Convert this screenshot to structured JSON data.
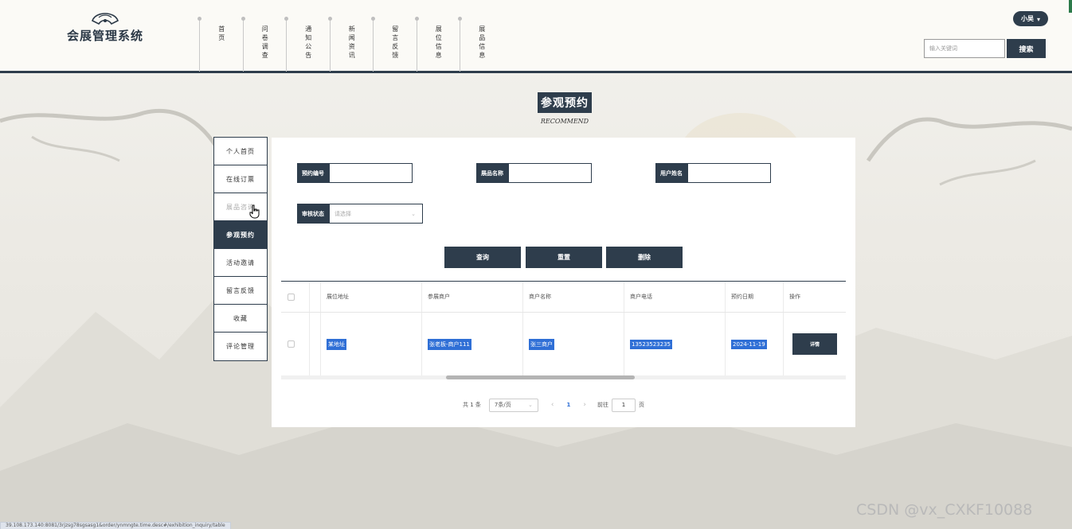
{
  "header": {
    "site_name": "会展管理系统",
    "nav": [
      "首页",
      "问卷调查",
      "通知公告",
      "新闻资讯",
      "留言反馈",
      "展位信息",
      "展品信息"
    ],
    "user_name": "小吴",
    "search_placeholder": "输入关键词",
    "search_button": "搜索"
  },
  "page": {
    "title": "参观预约",
    "subtitle": "RECOMMEND"
  },
  "side_menu": {
    "items": [
      "个人首页",
      "在线订票",
      "展品咨询",
      "参观预约",
      "活动邀请",
      "留言反馈",
      "收藏",
      "评论管理"
    ],
    "active": "参观预约"
  },
  "filters": {
    "booking_no_label": "预约编号",
    "booking_no_value": "",
    "exhibit_name_label": "展品名称",
    "exhibit_name_value": "",
    "user_name_label": "用户姓名",
    "user_name_value": "",
    "review_status_label": "审核状态",
    "review_status_placeholder": "请选择"
  },
  "buttons": {
    "query": "查询",
    "reset": "重置",
    "delete": "删除"
  },
  "table": {
    "columns": [
      "展位地址",
      "参展商户",
      "商户名称",
      "商户电话",
      "预约日期",
      "操作"
    ],
    "rows": [
      {
        "address": "某地址",
        "exhibitor": "张老板-商户111",
        "merchant_name": "张三商户",
        "merchant_phone": "13523523235",
        "booking_date": "2024-11-19",
        "action": "详情"
      }
    ]
  },
  "pagination": {
    "total": "共 1 条",
    "page_size": "7条/页",
    "current_page": "1",
    "goto_label": "前往",
    "goto_value": "1",
    "page_unit": "页"
  },
  "status_url": "39.108.173.140:8081/3rjzsg78sgsasg1&order/ynmngte.time.desc#/exhibition_inquiry/table",
  "watermark": "CSDN @vx_CXKF10088"
}
